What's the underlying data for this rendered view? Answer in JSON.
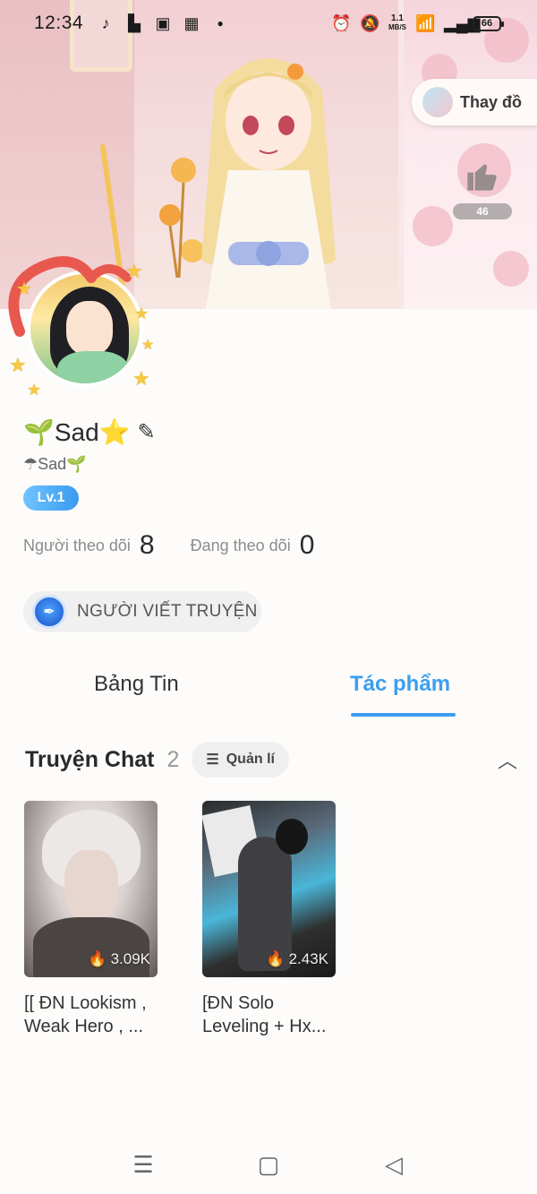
{
  "status_bar": {
    "time": "12:34",
    "net_speed_value": "1.1",
    "net_speed_unit": "MB/S",
    "battery": "66",
    "icons": [
      "tiktok-icon",
      "broom-icon",
      "youtube-icon",
      "app-icon",
      "dot-icon",
      "alarm-icon",
      "mute-icon",
      "wifi-icon",
      "signal-icon",
      "battery-icon"
    ]
  },
  "banner": {
    "change_outfit_label": "Thay đồ",
    "like_count": "46"
  },
  "profile": {
    "name": "🌱Sad⭐",
    "subname": "☂Sad🌱",
    "level": "Lv.1",
    "followers_label": "Người theo dõi",
    "followers_count": "8",
    "following_label": "Đang theo dõi",
    "following_count": "0",
    "role": "NGƯỜI VIẾT TRUYỆN"
  },
  "tabs": [
    {
      "label": "Bảng Tin",
      "active": false
    },
    {
      "label": "Tác phẩm",
      "active": true
    }
  ],
  "section": {
    "title": "Truyện Chat",
    "count": "2",
    "manage_label": "Quản lí"
  },
  "works": [
    {
      "views": "3.09K",
      "title_line1": "[[ ĐN Lookism ,",
      "title_line2": "Weak Hero , ..."
    },
    {
      "views": "2.43K",
      "title_line1": "[ĐN Solo",
      "title_line2": "Leveling + Hx..."
    }
  ],
  "colors": {
    "accent": "#3c9ef0",
    "level_badge": "#3a9af0",
    "page_bg": "#fdfcfa"
  }
}
